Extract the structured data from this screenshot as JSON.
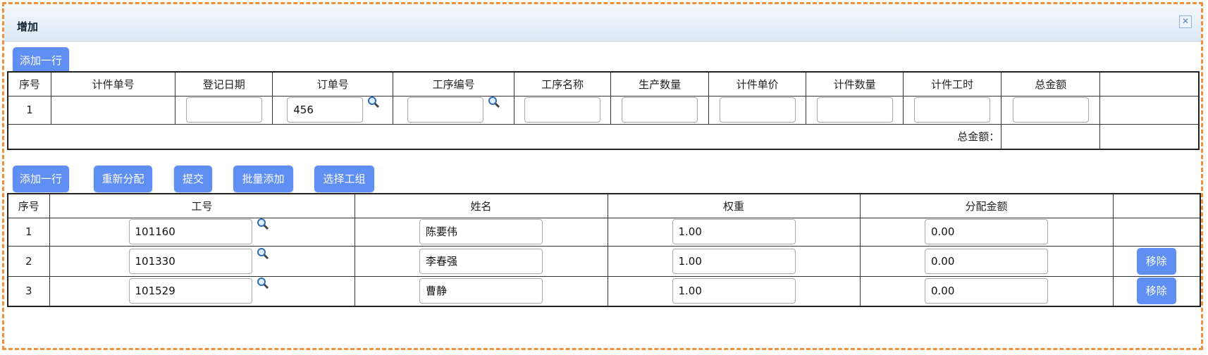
{
  "dialog": {
    "title": "增加",
    "close_symbol": "✕"
  },
  "top": {
    "add_row_label": "添加一行",
    "headers": [
      "序号",
      "计件单号",
      "登记日期",
      "订单号",
      "工序编号",
      "工序名称",
      "生产数量",
      "计件单价",
      "计件数量",
      "计件工时",
      "总金额",
      ""
    ],
    "row": {
      "seq": "1",
      "piece_no": "",
      "reg_date": "",
      "order_no": "456",
      "proc_code": "",
      "proc_name": "",
      "prod_qty": "",
      "unit_price": "",
      "piece_qty": "",
      "piece_hours": "",
      "total": ""
    },
    "total_label": "总金额：",
    "total_value": ""
  },
  "bottom": {
    "buttons": {
      "add_row": "添加一行",
      "reassign": "重新分配",
      "submit": "提交",
      "batch_add": "批量添加",
      "select_group": "选择工组"
    },
    "headers": [
      "序号",
      "工号",
      "姓名",
      "权重",
      "分配金额",
      ""
    ],
    "rows": [
      {
        "seq": "1",
        "emp_no": "101160",
        "name": "陈要伟",
        "weight": "1.00",
        "amount": "0.00",
        "remove": ""
      },
      {
        "seq": "2",
        "emp_no": "101330",
        "name": "李春强",
        "weight": "1.00",
        "amount": "0.00",
        "remove": "移除"
      },
      {
        "seq": "3",
        "emp_no": "101529",
        "name": "曹静",
        "weight": "1.00",
        "amount": "0.00",
        "remove": "移除"
      }
    ]
  },
  "colors": {
    "button": "#5f8ff2",
    "frame": "#f0913f"
  }
}
